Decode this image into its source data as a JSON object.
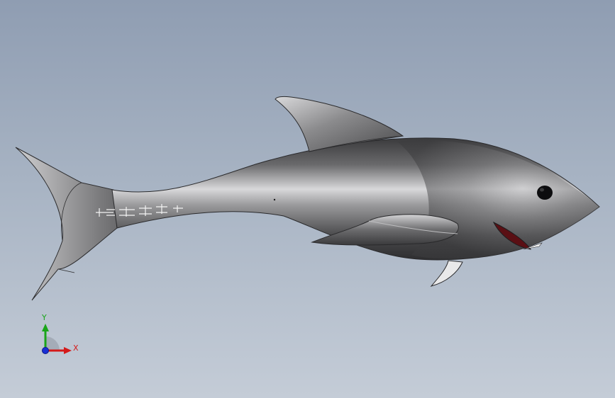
{
  "viewport": {
    "background_top": "#8f9db2",
    "background_bottom": "#c4ccd7"
  },
  "model": {
    "name": "shark",
    "body_color": "#6e6e70",
    "highlight_color": "#e8e8ea",
    "mouth_color": "#5a0f14",
    "teeth_color": "#f2f2f2"
  },
  "triad": {
    "x_label": "X",
    "y_label": "Y",
    "x_color": "#d41a1a",
    "y_color": "#1aa51a",
    "z_color": "#1a2fd4"
  }
}
